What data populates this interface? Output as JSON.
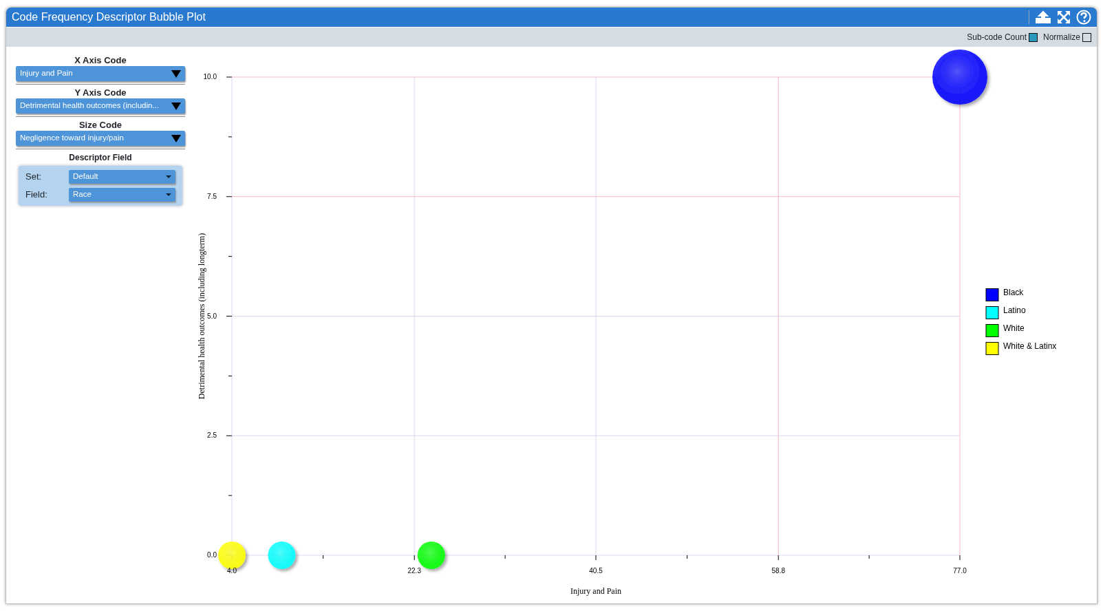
{
  "window": {
    "title": "Code Frequency Descriptor Bubble Plot"
  },
  "toolbar": {
    "options": [
      {
        "label": "Sub-code Count",
        "checked": true
      },
      {
        "label": "Normalize",
        "checked": false
      }
    ]
  },
  "controls": {
    "x_axis": {
      "label": "X Axis Code",
      "value": "Injury and Pain"
    },
    "y_axis": {
      "label": "Y Axis Code",
      "value": "Detrimental health outcomes (includin..."
    },
    "size": {
      "label": "Size Code",
      "value": "Negligence toward injury/pain"
    },
    "descriptor": {
      "label": "Descriptor Field",
      "fields": [
        {
          "label": "Set:",
          "value": "Default"
        },
        {
          "label": "Field:",
          "value": "Race"
        }
      ]
    }
  },
  "plot": {
    "chart_data": {
      "type": "scatter",
      "grid": true,
      "legend": true,
      "xlabel": "Injury and Pain",
      "ylabel": "Detrimental health outcomes (including longterm)",
      "x": [
        4.0,
        9.0,
        24.0,
        77.0
      ],
      "series": [
        {
          "name": "Black",
          "color": "#0000ff",
          "values": [
            null,
            null,
            null,
            10.0
          ]
        },
        {
          "name": "Latino",
          "color": "#00ffff",
          "values": [
            null,
            0.0,
            null,
            null
          ]
        },
        {
          "name": "White",
          "color": "#00ff00",
          "values": [
            null,
            null,
            0.0,
            null
          ]
        },
        {
          "name": "White & Latinx",
          "color": "#ffff00",
          "values": [
            0.0,
            null,
            null,
            null
          ]
        }
      ],
      "xlim": [
        4.0,
        77.0
      ],
      "ylim": [
        0.0,
        10.0
      ],
      "xticks": [
        {
          "value": 4.0,
          "label": "4.0"
        },
        {
          "value": 22.3,
          "label": "22.3"
        },
        {
          "value": 40.5,
          "label": "40.5"
        },
        {
          "value": 58.8,
          "label": "58.8"
        },
        {
          "value": 77.0,
          "label": "77.0"
        }
      ],
      "yticks": [
        {
          "value": 0.0,
          "label": "0.0"
        },
        {
          "value": 2.5,
          "label": "2.5"
        },
        {
          "value": 5.0,
          "label": "5.0"
        },
        {
          "value": 7.5,
          "label": "7.5"
        },
        {
          "value": 10.0,
          "label": "10.0"
        }
      ]
    }
  }
}
